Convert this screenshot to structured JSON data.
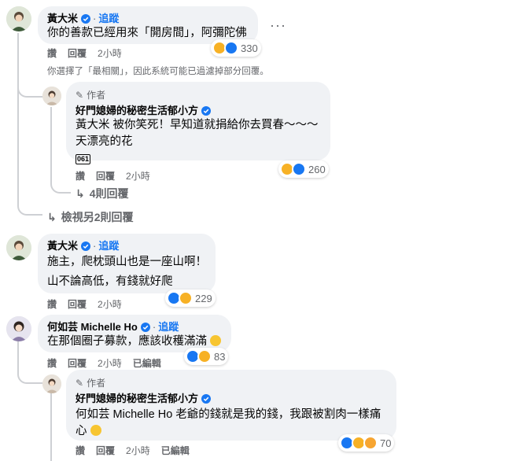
{
  "colors": {
    "accent": "#1877f2",
    "bubble": "#f0f2f5",
    "muted": "#65676b"
  },
  "icons": {
    "verified": "verified-badge-icon",
    "like": "like-reaction-icon",
    "haha": "haha-reaction-icon",
    "care": "care-reaction-icon",
    "reply_arrow": "reply-arrow-icon",
    "pen": "author-pen-icon",
    "more": "more-options-icon"
  },
  "comments": [
    {
      "name": "黃大米",
      "follow": "追蹤",
      "text": "你的善款已經用來「開房間」，阿彌陀佛",
      "actions": {
        "like": "讚",
        "reply": "回覆",
        "time": "2小時"
      },
      "reactions": {
        "count": "330"
      }
    },
    {
      "author_label": "作者",
      "name": "好門媳婦的秘密生活郁小方",
      "lines": [
        "黃大米 被你笑死！早知道就捐給你去買春～～～",
        "天漂亮的花"
      ],
      "icon_text": "061",
      "actions": {
        "like": "讚",
        "reply": "回覆",
        "time": "2小時"
      },
      "reactions": {
        "count": "260"
      }
    },
    {
      "name": "黃大米",
      "follow": "追蹤",
      "lines": [
        "施主，爬枕頭山也是一座山啊！",
        "山不論高低，有錢就好爬"
      ],
      "actions": {
        "like": "讚",
        "reply": "回覆",
        "time": "2小時"
      },
      "reactions": {
        "count": "229"
      }
    },
    {
      "name": "何如芸 Michelle Ho",
      "follow": "追蹤",
      "text": "在那個圈子募款，應該收穫滿滿",
      "actions": {
        "like": "讚",
        "reply": "回覆",
        "time": "2小時",
        "edited": "已編輯"
      },
      "reactions": {
        "count": "83"
      }
    },
    {
      "author_label": "作者",
      "name": "好門媳婦的秘密生活郁小方",
      "lines": [
        "何如芸 Michelle Ho 老爺的錢就是我的錢，我跟被割肉一樣痛",
        "心"
      ],
      "actions": {
        "like": "讚",
        "reply": "回覆",
        "time": "2小時",
        "edited": "已編輯"
      },
      "reactions": {
        "count": "70"
      }
    }
  ],
  "notice": "你選擇了「最相關」，因此系統可能已過濾掉部分回覆。",
  "more_replies": "4則回覆",
  "view_more": "檢視另2則回覆",
  "more_label": "···"
}
